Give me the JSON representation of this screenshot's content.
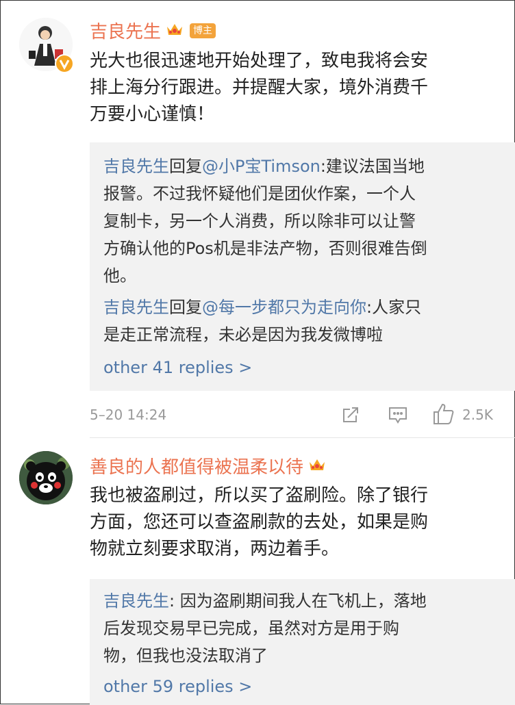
{
  "comments": [
    {
      "username": "吉良先生",
      "badge": "博主",
      "lines": [
        "光大也很迅速地开始处理了，致电我将会安",
        "排上海分行跟进。并提醒大家，境外消费千",
        "万要小心谨慎！"
      ],
      "replies": [
        {
          "author": "吉良先生",
          "reply_word": "回复",
          "target": "@小P宝Timson",
          "first": ":建议法国当地",
          "rest": [
            "报警。不过我怀疑他们是团伙作案，一个人",
            "复制卡，另一个人消费，所以除非可以让警",
            "方确认他的Pos机是非法产物，否则很难告倒",
            "他。"
          ]
        },
        {
          "author": "吉良先生",
          "reply_word": "回复",
          "target": "@每一步都只为走向你",
          "first": ":人家只",
          "rest": [
            "是走正常流程，未必是因为我发微博啦"
          ]
        }
      ],
      "more_replies": "other 41 replies >",
      "time": "5–20 14:24",
      "like_count": "2.5K"
    },
    {
      "username": "善良的人都值得被温柔以待",
      "lines": [
        "我也被盗刷过，所以买了盗刷险。除了银行",
        "方面，您还可以查盗刷款的去处，如果是购",
        "物就立刻要求取消，两边着手。"
      ],
      "reply": {
        "author": "吉良先生",
        "first": ": 因为盗刷期间我人在飞机上，落地",
        "rest": [
          "后发现交易早已完成，虽然对方是用于购",
          "物，但我也没法取消了"
        ]
      },
      "more_replies": "other 59 replies >"
    }
  ],
  "colors": {
    "username": "#eb7350",
    "link": "#5178a8",
    "reply_bg": "#f2f2f2",
    "meta": "#999999"
  }
}
